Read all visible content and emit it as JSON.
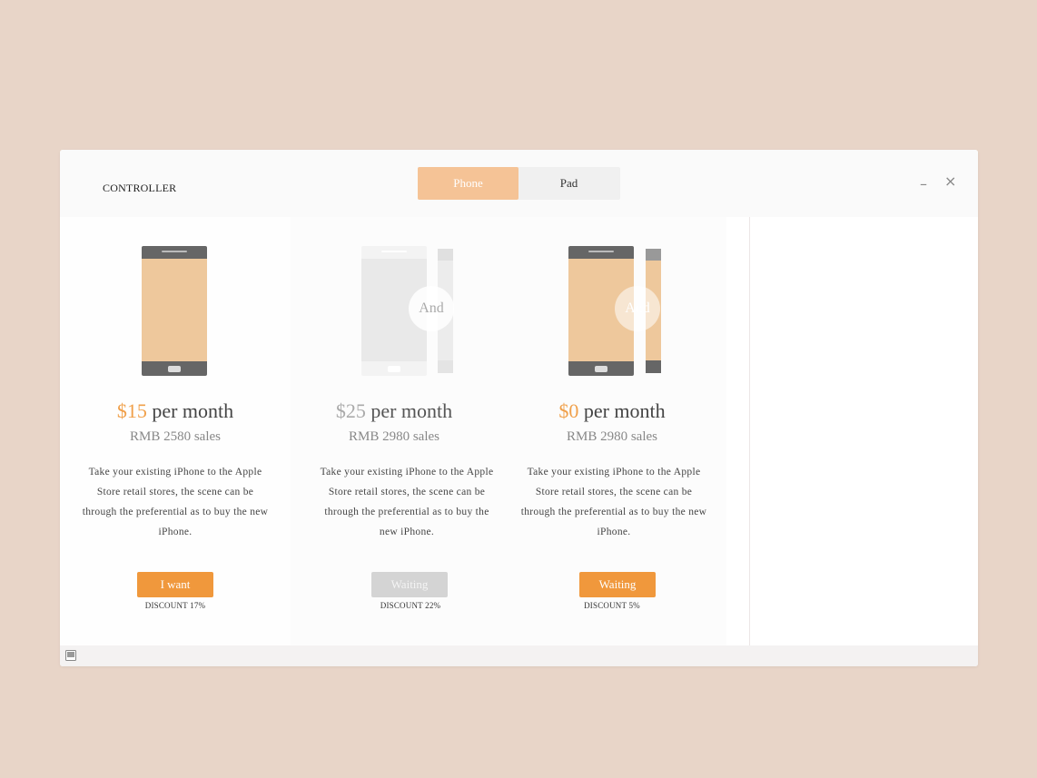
{
  "window": {
    "title": "CONTROLLER",
    "tabs": [
      {
        "label": "Phone",
        "active": true
      },
      {
        "label": "Pad",
        "active": false
      }
    ],
    "minimize_label": "–",
    "close_label": "×"
  },
  "plans": [
    {
      "amount": "$15",
      "suffix": "per month",
      "sales": "RMB 2580 sales",
      "description": "Take your existing iPhone to the Apple Store retail stores, the scene can be through the preferential as to buy the new iPhone.",
      "button_label": "I want",
      "button_state": "active",
      "discount": "DISCOUNT 17%"
    },
    {
      "amount": "$25",
      "suffix": "per month",
      "sales": "RMB 2980 sales",
      "description": "Take your existing iPhone to the Apple Store retail stores, the scene can be through the preferential as to buy the new iPhone.",
      "button_label": "Waiting",
      "button_state": "disabled",
      "connector_label": "And",
      "discount": "DISCOUNT 22%"
    },
    {
      "amount": "$0",
      "suffix": "per month",
      "sales": "RMB 2980 sales",
      "description": "Take your existing iPhone to the Apple Store retail stores, the scene can be through the preferential as to buy the new iPhone.",
      "button_label": "Waiting",
      "button_state": "active",
      "connector_label": "And",
      "discount": "DISCOUNT 5%"
    }
  ],
  "icons": {
    "phone": "phone-icon",
    "tablet": "tablet-side-icon",
    "status": "panel-icon"
  },
  "colors": {
    "accent": "#f0983c",
    "accent_light": "#f5c396",
    "phone_screen": "#eec89c",
    "phone_frame": "#666666",
    "background": "#e8d5c8"
  }
}
